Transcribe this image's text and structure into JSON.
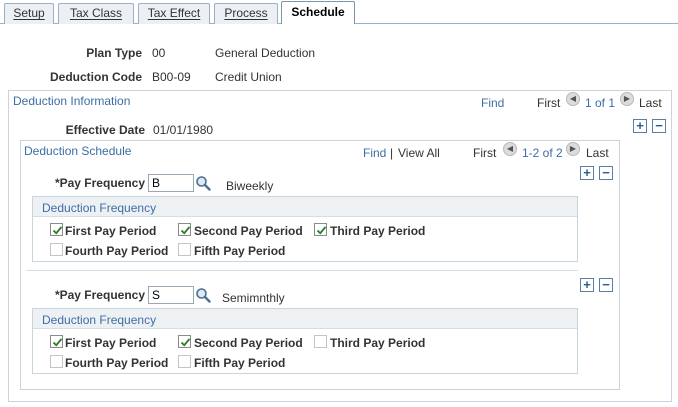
{
  "tabs": [
    {
      "label": "Setup",
      "active": false
    },
    {
      "label": "Tax Class",
      "active": false
    },
    {
      "label": "Tax Effect",
      "active": false
    },
    {
      "label": "Process",
      "active": false
    },
    {
      "label": "Schedule",
      "active": true
    }
  ],
  "header": {
    "plan_type_label": "Plan Type",
    "plan_type_code": "00",
    "plan_type_desc": "General Deduction",
    "deduction_code_label": "Deduction Code",
    "deduction_code_value": "B00-09",
    "deduction_code_desc": "Credit Union"
  },
  "deduction_info": {
    "title": "Deduction Information",
    "find": "Find",
    "first": "First",
    "count": "1 of 1",
    "last": "Last",
    "effective_date_label": "Effective Date",
    "effective_date_value": "01/01/1980"
  },
  "schedule": {
    "title": "Deduction Schedule",
    "find": "Find",
    "view_all": "View All",
    "separator": "|",
    "first": "First",
    "count": "1-2 of 2",
    "last": "Last",
    "rows": [
      {
        "pay_frequency_label": "*Pay Frequency",
        "pay_frequency_value": "B",
        "pay_frequency_desc": "Biweekly",
        "freq_title": "Deduction Frequency",
        "periods": [
          {
            "label": "First Pay Period",
            "checked": true
          },
          {
            "label": "Second Pay Period",
            "checked": true
          },
          {
            "label": "Third Pay Period",
            "checked": true
          },
          {
            "label": "Fourth Pay Period",
            "checked": false
          },
          {
            "label": "Fifth Pay Period",
            "checked": false
          }
        ]
      },
      {
        "pay_frequency_label": "*Pay Frequency",
        "pay_frequency_value": "S",
        "pay_frequency_desc": "Semimnthly",
        "freq_title": "Deduction Frequency",
        "periods": [
          {
            "label": "First Pay Period",
            "checked": true
          },
          {
            "label": "Second Pay Period",
            "checked": true
          },
          {
            "label": "Third Pay Period",
            "checked": false
          },
          {
            "label": "Fourth Pay Period",
            "checked": false
          },
          {
            "label": "Fifth Pay Period",
            "checked": false
          }
        ]
      }
    ]
  },
  "colors": {
    "link": "#3b6ea5",
    "tab_border": "#9ab0c4",
    "group_border": "#c8d4de"
  },
  "icons": {
    "prev": "left-arrow-icon",
    "next": "right-arrow-icon",
    "add": "plus-icon",
    "remove": "minus-icon",
    "lookup": "magnifier-icon",
    "check": "checkmark-icon"
  }
}
